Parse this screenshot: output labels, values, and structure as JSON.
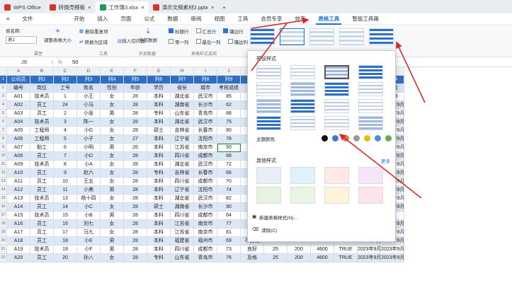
{
  "tabs": [
    {
      "label": "WPS Office",
      "color": "#d6332a"
    },
    {
      "label": "转换壳模板",
      "color": "#d6332a"
    },
    {
      "label": "工作簿3.xlsx",
      "color": "#1e9c5a"
    },
    {
      "label": "演示文稿素材2.pptx",
      "color": "#d6332a"
    }
  ],
  "menu": [
    "文件",
    "开始",
    "插入",
    "页面",
    "公式",
    "数据",
    "审阅",
    "视图",
    "工具",
    "会员专享",
    "效率",
    "表格工具",
    "智能工具箱"
  ],
  "ribbon": {
    "table_name_label": "表名称:",
    "table_name_value": "表1",
    "resize": "调整表格大小",
    "group_props": "属性",
    "remove_dup": "删除重复项",
    "convert_range": "转换为区域",
    "insert_slicer": "插入切片器",
    "group_tools": "工具",
    "export": "外部数据",
    "group_external": "外部数据",
    "opt_header": "标题行",
    "opt_total": "汇总行",
    "opt_banded_row": "镶边行",
    "opt_first_col": "第一列",
    "opt_last_col": "最后一列",
    "opt_banded_col": "镶边列",
    "group_style_opts": "表格样式选项"
  },
  "fx": {
    "cell_ref": "J9",
    "fx": "fx",
    "value": "50"
  },
  "columns": [
    "A",
    "B",
    "C",
    "D",
    "E",
    "F",
    "G",
    "H",
    "I",
    "J",
    "K",
    "L",
    "M",
    "N",
    "O",
    "P",
    "Q"
  ],
  "header_row": [
    "公司员",
    "列1",
    "列2",
    "列3",
    "列4",
    "列5",
    "列6",
    "列7",
    "列8",
    "列9"
  ],
  "sub_row": [
    "编号",
    "岗位",
    "工号",
    "姓名",
    "性别",
    "年龄",
    "学历",
    "省份",
    "城市",
    "考核成绩"
  ],
  "rows": [
    [
      "A01",
      "技术员",
      "1",
      "小王",
      "女",
      "28",
      "本科",
      "湖北省",
      "武汉市",
      "85"
    ],
    [
      "A02",
      "员工",
      "24",
      "小马",
      "女",
      "28",
      "本科",
      "湖南省",
      "长沙市",
      "62"
    ],
    [
      "A03",
      "员工",
      "2",
      "小张",
      "男",
      "28",
      "专科",
      "山东省",
      "青岛市",
      "88"
    ],
    [
      "A04",
      "技术员",
      "3",
      "陈一",
      "女",
      "28",
      "本科",
      "湖北省",
      "武汉市",
      "75"
    ],
    [
      "A05",
      "工程师",
      "4",
      "小G",
      "女",
      "28",
      "硕士",
      "吉林省",
      "长春市",
      "80"
    ],
    [
      "A06",
      "工程师",
      "5",
      "小子",
      "女",
      "27",
      "本科",
      "辽宁省",
      "沈阳市",
      "78"
    ],
    [
      "A07",
      "助工",
      "6",
      "小明",
      "男",
      "26",
      "本科",
      "江苏省",
      "南京市",
      "50"
    ],
    [
      "A08",
      "员工",
      "7",
      "小D",
      "女",
      "28",
      "本科",
      "四川省",
      "成都市",
      "68"
    ],
    [
      "A09",
      "技术员",
      "8",
      "小A",
      "女",
      "28",
      "本科",
      "湖北省",
      "武汉市",
      "72"
    ],
    [
      "A10",
      "员工",
      "9",
      "赵六",
      "女",
      "28",
      "专科",
      "吉林省",
      "长春市",
      "66"
    ],
    [
      "A11",
      "员工",
      "10",
      "王五",
      "女",
      "28",
      "本科",
      "四川省",
      "成都市",
      "70"
    ],
    [
      "A12",
      "员工",
      "11",
      "小美",
      "男",
      "28",
      "本科",
      "辽宁省",
      "沈阳市",
      "74"
    ],
    [
      "A13",
      "技术员",
      "13",
      "杨十四",
      "女",
      "28",
      "本科",
      "湖北省",
      "武汉市",
      "82"
    ],
    [
      "A14",
      "员工",
      "14",
      "小C",
      "女",
      "28",
      "硕士",
      "湖南省",
      "长沙市",
      "90"
    ],
    [
      "A15",
      "技术员",
      "15",
      "小B",
      "男",
      "28",
      "本科",
      "四川省",
      "成都市",
      "64"
    ],
    [
      "A16",
      "员工",
      "16",
      "刘七",
      "女",
      "28",
      "本科",
      "江苏省",
      "南京市",
      "77"
    ],
    [
      "A17",
      "员工",
      "17",
      "马九",
      "女",
      "28",
      "本科",
      "江苏省",
      "南京市",
      "81"
    ],
    [
      "A18",
      "员工",
      "18",
      "小E",
      "男",
      "28",
      "本科",
      "福建省",
      "福州市",
      "69"
    ],
    [
      "A19",
      "技术员",
      "19",
      "小F",
      "男",
      "28",
      "本科",
      "四川省",
      "成都市",
      "73"
    ],
    [
      "A20",
      "员工",
      "20",
      "孙八",
      "女",
      "28",
      "专科",
      "山东省",
      "青岛市",
      "76"
    ]
  ],
  "right_cols": [
    [
      "及格",
      "20",
      "200",
      "4600",
      "FALSE",
      "2023年9月25日"
    ],
    [
      "及格",
      "20",
      "200",
      "4600",
      "TRUE",
      "2023年9月25日"
    ],
    [
      "不及格",
      "25",
      "200",
      "4600",
      "TRUE",
      "2023年9月25日"
    ],
    [
      "良好",
      "25",
      "200",
      "4600",
      "TRUE",
      "2023年9月25日"
    ],
    [
      "及格",
      "25",
      "200",
      "4600",
      "TRUE",
      "2023年9月25日"
    ]
  ],
  "right_header": [
    "列14",
    "列15"
  ],
  "right_partial": [
    "日期",
    "2023",
    "2023年9月",
    "2023年9月",
    "2023年9月",
    "2023年9月",
    "2023年9月",
    "2023年9月",
    "2023年9月",
    "2023年9月",
    "2023年9月",
    "2023年9月",
    "2023年9月",
    "2023年9月",
    "2023年9月"
  ],
  "panel": {
    "preset": "预设样式",
    "theme": "主题颜色",
    "other": "其他样式",
    "more": "更多",
    "new_style": "新建表格样式(N)...",
    "clear": "清除(C)"
  },
  "theme_colors": [
    "#111111",
    "#3f78c9",
    "#e07b39",
    "#9a9a9a",
    "#e8b71a",
    "#4b8fd6",
    "#6bab4a"
  ]
}
